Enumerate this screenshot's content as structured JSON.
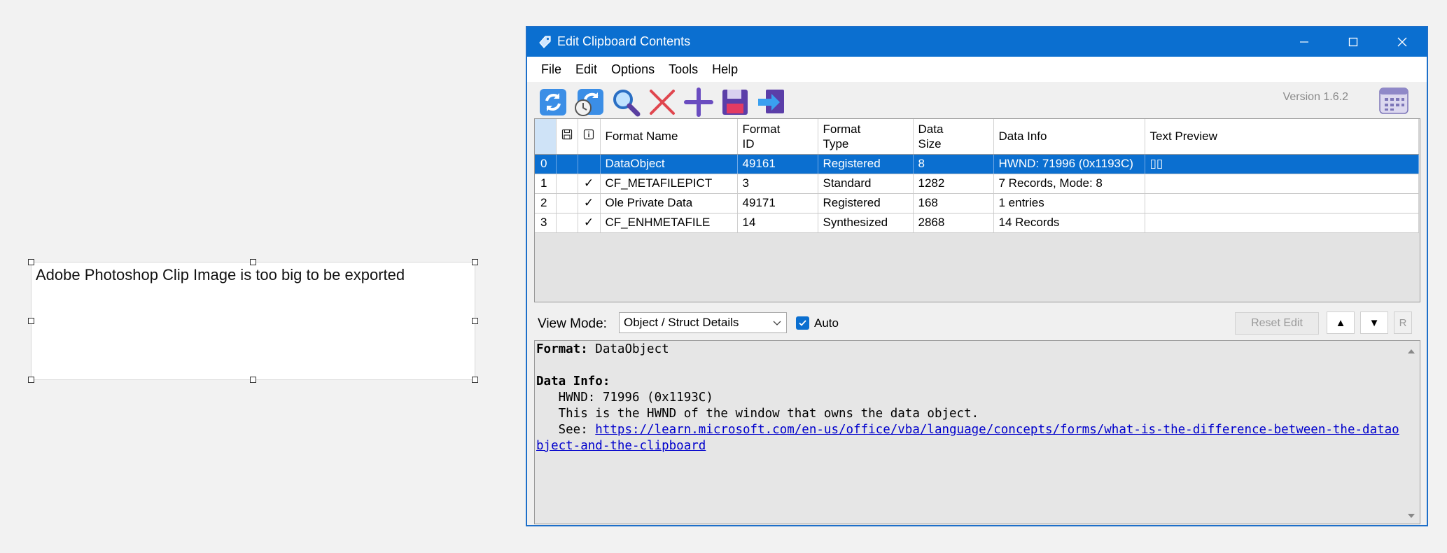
{
  "clip": {
    "message": "Adobe Photoshop Clip Image is too big to be exported"
  },
  "window": {
    "title": "Edit Clipboard Contents",
    "version": "Version 1.6.2",
    "accent": "#0b6fd0"
  },
  "menu": [
    "File",
    "Edit",
    "Options",
    "Tools",
    "Help"
  ],
  "toolbar": {
    "icons": [
      "refresh-icon",
      "refresh-timed-icon",
      "magnifier-icon",
      "delete-x-icon",
      "add-plus-icon",
      "save-floppy-icon",
      "export-arrow-icon",
      "calendar-icon"
    ]
  },
  "grid": {
    "headers": [
      "",
      "",
      "",
      "Format Name",
      "Format ID",
      "Format Type",
      "Data Size",
      "Data Info",
      "Text Preview"
    ],
    "rows": [
      {
        "index": "0",
        "saved": "",
        "info": "",
        "name": "DataObject",
        "id": "49161",
        "type": "Registered",
        "size": "8",
        "data_info": "HWND: 71996 (0x1193C)",
        "preview": "▯▯",
        "selected": true
      },
      {
        "index": "1",
        "saved": "",
        "info": "✓",
        "name": "CF_METAFILEPICT",
        "id": "3",
        "type": "Standard",
        "size": "1282",
        "data_info": "7 Records, Mode: 8",
        "preview": ""
      },
      {
        "index": "2",
        "saved": "",
        "info": "✓",
        "name": "Ole Private Data",
        "id": "49171",
        "type": "Registered",
        "size": "168",
        "data_info": "1 entries",
        "preview": ""
      },
      {
        "index": "3",
        "saved": "",
        "info": "✓",
        "name": "CF_ENHMETAFILE",
        "id": "14",
        "type": "Synthesized",
        "size": "2868",
        "data_info": "14 Records",
        "preview": ""
      }
    ]
  },
  "view": {
    "label": "View Mode:",
    "mode": "Object / Struct Details",
    "auto_label": "Auto",
    "auto_checked": true,
    "reset_label": "Reset Edit",
    "up_label": "▲",
    "down_label": "▼",
    "r_label": "R"
  },
  "details": {
    "format_label": "Format:",
    "format_value": " DataObject",
    "data_info_label": "Data Info:",
    "line1": "   HWND: 71996 (0x1193C)",
    "line2": "   This is the HWND of the window that owns the data object.",
    "see_label": "   See: ",
    "link": "https://learn.microsoft.com/en-us/office/vba/language/concepts/forms/what-is-the-difference-between-the-dataobject-and-the-clipboard"
  }
}
